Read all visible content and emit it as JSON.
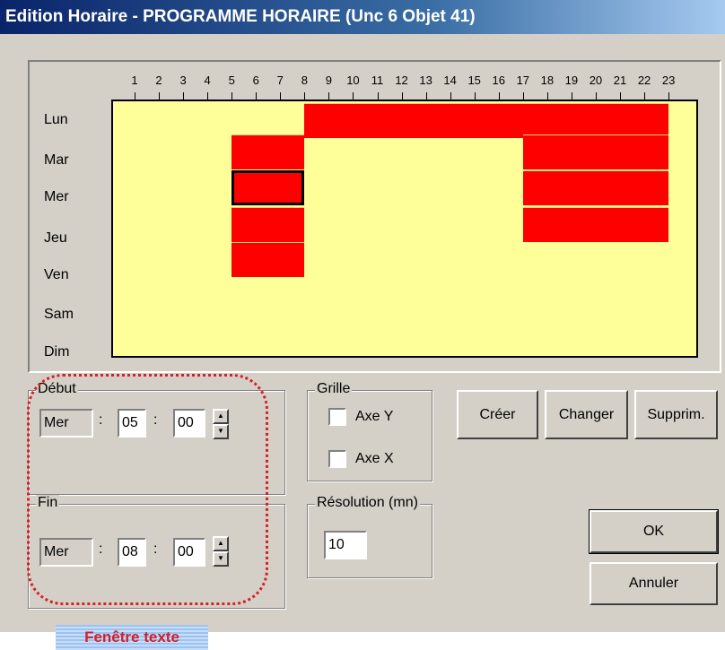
{
  "window": {
    "title": "Edition Horaire - PROGRAMME HORAIRE (Unc 6 Objet 41)"
  },
  "schedule": {
    "hours": [
      "1",
      "2",
      "3",
      "4",
      "5",
      "6",
      "7",
      "8",
      "9",
      "10",
      "11",
      "12",
      "13",
      "14",
      "15",
      "16",
      "17",
      "18",
      "19",
      "20",
      "21",
      "22",
      "23"
    ],
    "days": [
      "Lun",
      "Mar",
      "Mer",
      "Jeu",
      "Ven",
      "Sam",
      "Dim"
    ],
    "blocks": [
      {
        "day": "Lun",
        "start": "08:00",
        "end": "23:00",
        "selected": false
      },
      {
        "day": "Mar",
        "start": "05:00",
        "end": "08:00",
        "selected": false
      },
      {
        "day": "Mar",
        "start": "17:00",
        "end": "23:00",
        "selected": false
      },
      {
        "day": "Mer",
        "start": "05:00",
        "end": "08:00",
        "selected": true
      },
      {
        "day": "Mer",
        "start": "17:00",
        "end": "23:00",
        "selected": false
      },
      {
        "day": "Jeu",
        "start": "05:00",
        "end": "08:00",
        "selected": false
      },
      {
        "day": "Jeu",
        "start": "17:00",
        "end": "23:00",
        "selected": false
      },
      {
        "day": "Ven",
        "start": "05:00",
        "end": "08:00",
        "selected": false
      }
    ],
    "colors": {
      "background": "#ffff99",
      "block": "#ff0000"
    }
  },
  "debut": {
    "label": "Début",
    "day": "Mer",
    "hour": "05",
    "minute": "00",
    "sep": ":"
  },
  "fin": {
    "label": "Fin",
    "day": "Mer",
    "hour": "08",
    "minute": "00",
    "sep": ":"
  },
  "grille": {
    "label": "Grille",
    "axe_y": "Axe Y",
    "axe_x": "Axe X",
    "axe_y_checked": false,
    "axe_x_checked": false
  },
  "resolution": {
    "label": "Résolution (mn)",
    "value": "10"
  },
  "buttons": {
    "creer": "Créer",
    "changer": "Changer",
    "supprimer": "Supprim.",
    "ok": "OK",
    "annuler": "Annuler"
  },
  "callout": {
    "caption": "Fenêtre texte"
  }
}
